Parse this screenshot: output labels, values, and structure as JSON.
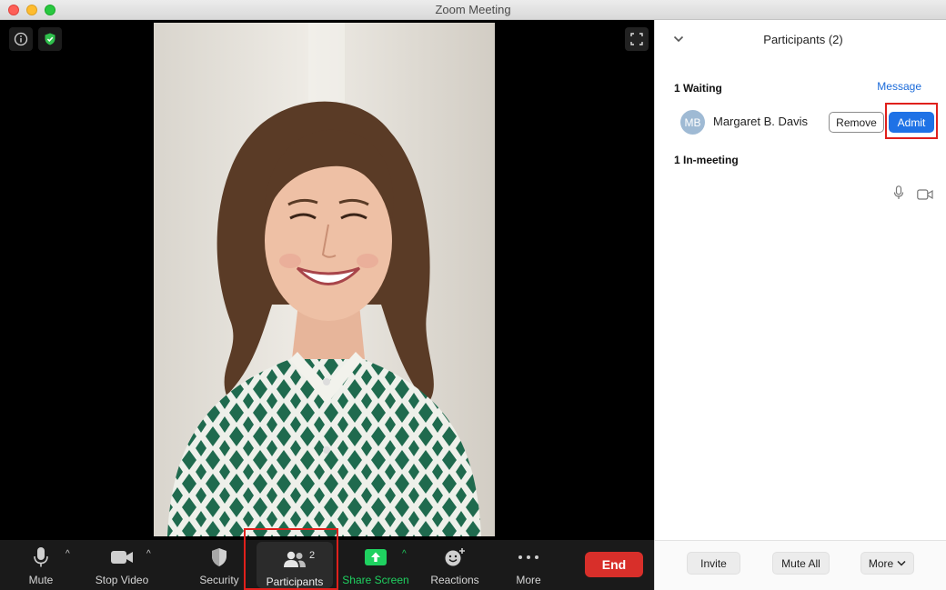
{
  "window": {
    "title": "Zoom Meeting"
  },
  "toolbar": {
    "mute_label": "Mute",
    "stop_video_label": "Stop Video",
    "security_label": "Security",
    "participants_label": "Participants",
    "participants_count": "2",
    "share_screen_label": "Share Screen",
    "reactions_label": "Reactions",
    "more_label": "More",
    "end_label": "End"
  },
  "panel": {
    "title": "Participants (2)",
    "waiting_label": "1 Waiting",
    "message_link": "Message",
    "waiting_participant": {
      "initials": "MB",
      "name": "Margaret B. Davis"
    },
    "remove_label": "Remove",
    "admit_label": "Admit",
    "in_meeting_label": "1 In-meeting",
    "footer": {
      "invite_label": "Invite",
      "mute_all_label": "Mute All",
      "more_label": "More"
    }
  },
  "colors": {
    "end_button": "#d82f2a",
    "admit_button": "#1f72e6",
    "share_screen": "#1fd160",
    "highlight": "#e0201c"
  },
  "icons": [
    "info-icon",
    "shield-check-icon",
    "fullscreen-icon",
    "microphone-icon",
    "video-camera-icon",
    "security-shield-icon",
    "participants-icon",
    "share-screen-arrow-icon",
    "reactions-icon",
    "more-dots-icon",
    "chevron-down-icon",
    "chevron-up-icon"
  ]
}
